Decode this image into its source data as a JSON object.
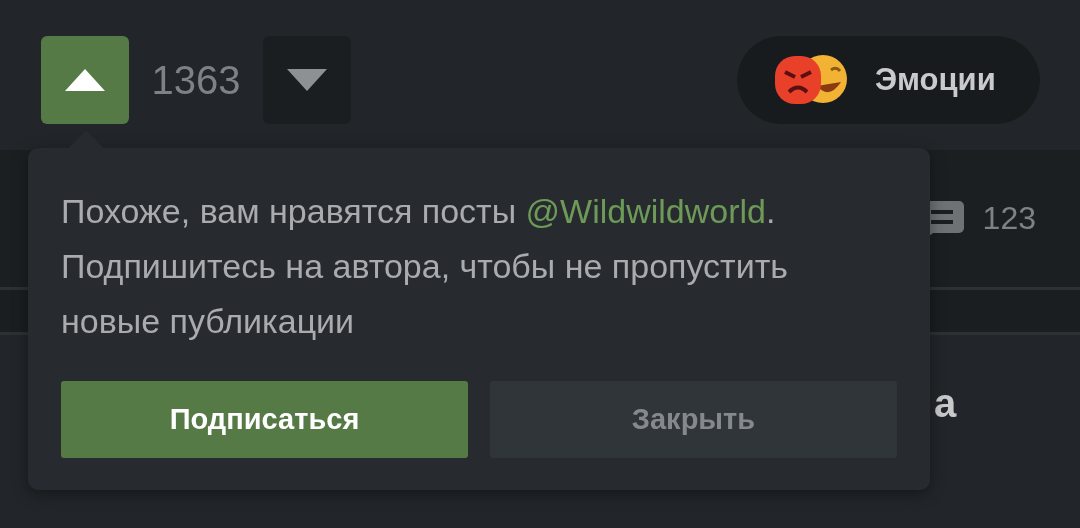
{
  "vote": {
    "upvote": {
      "selected": true
    },
    "score": "1363",
    "downvote": {
      "selected": false
    }
  },
  "emotions_button": {
    "label": "Эмоции"
  },
  "comments": {
    "count": "123"
  },
  "post_title": {
    "line_1_end": "а"
  },
  "popup": {
    "text_before": "Похоже, вам нравятся посты ",
    "author_link": "@Wildwildworld",
    "text_after": ". Подпишитесь на автора, чтобы не пропустить новые публикации",
    "buttons": [
      {
        "label": "Подписаться",
        "kind": "primary"
      },
      {
        "label": "Закрыть",
        "kind": "secondary"
      }
    ]
  }
}
